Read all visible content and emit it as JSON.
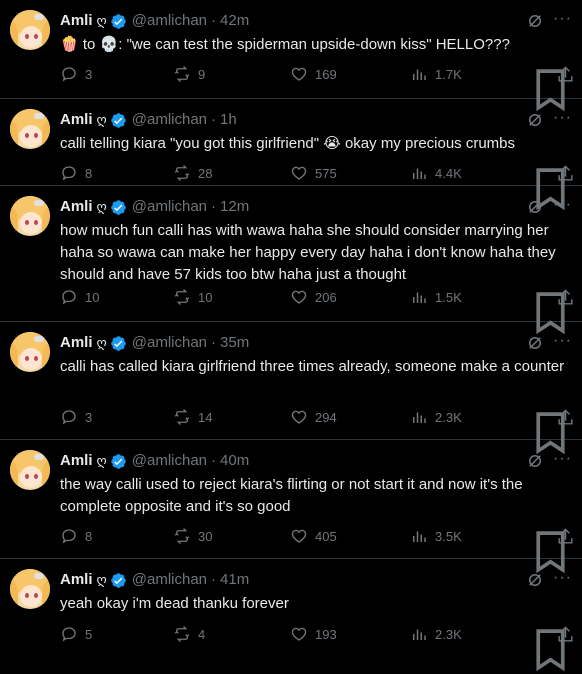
{
  "colors": {
    "background": "#000000",
    "text": "#e7e9ea",
    "muted": "#71767b",
    "verified": "#1d9bf0",
    "divider": "#2f3336"
  },
  "user": {
    "name": "Amli",
    "name_glyph": "ღ",
    "handle": "@amlichan",
    "avatar_icon": "avatar-icon"
  },
  "tweets": [
    {
      "time": "42m",
      "text_parts": {
        "pre": "",
        "emoji1": "🍿",
        "mid": " to ",
        "emoji2": "💀",
        "post": ": \"we can test the spiderman upside-down kiss\" HELLO???"
      },
      "replies": "3",
      "retweets": "9",
      "likes": "169",
      "views": "1.7K"
    },
    {
      "time": "1h",
      "text": "calli telling kiara \"you got this girlfriend\" 😭 okay my precious crumbs",
      "replies": "8",
      "retweets": "28",
      "likes": "575",
      "views": "4.4K"
    },
    {
      "time": "12m",
      "text": "how much fun calli has with wawa haha she should consider marrying her haha so wawa can make her happy every day haha i don't know haha they should and have 57 kids too btw haha just a thought",
      "replies": "10",
      "retweets": "10",
      "likes": "206",
      "views": "1.5K"
    },
    {
      "time": "35m",
      "text": "calli has called kiara girlfriend three times already, someone make a counter",
      "replies": "3",
      "retweets": "14",
      "likes": "294",
      "views": "2.3K"
    },
    {
      "time": "40m",
      "text": "the way calli used to reject kiara's flirting or not start it and now it's the complete opposite and it's so good",
      "replies": "8",
      "retweets": "30",
      "likes": "405",
      "views": "3.5K"
    },
    {
      "time": "41m",
      "text": "yeah okay i'm dead thanku forever",
      "replies": "5",
      "retweets": "4",
      "likes": "193",
      "views": "2.3K"
    }
  ],
  "dot_separator": "·",
  "more_label": "···"
}
